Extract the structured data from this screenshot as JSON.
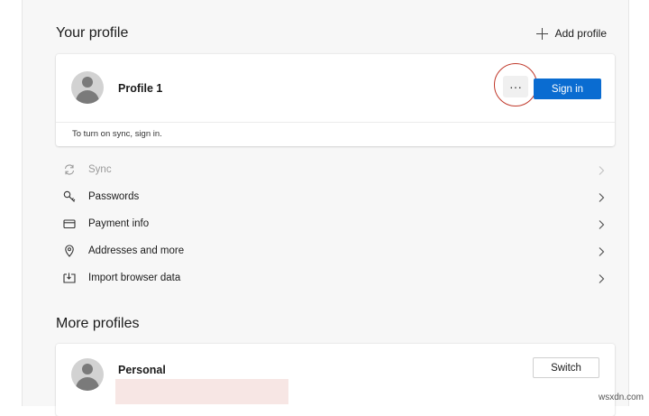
{
  "your_profile": {
    "title": "Your profile",
    "add_profile_label": "Add profile",
    "profile_name": "Profile 1",
    "more_label": "···",
    "sign_in_label": "Sign in",
    "sync_note": "To turn on sync, sign in."
  },
  "settings_items": [
    {
      "label": "Sync",
      "icon": "sync-icon",
      "disabled": true
    },
    {
      "label": "Passwords",
      "icon": "key-icon",
      "disabled": false
    },
    {
      "label": "Payment info",
      "icon": "credit-card-icon",
      "disabled": false
    },
    {
      "label": "Addresses and more",
      "icon": "location-pin-icon",
      "disabled": false
    },
    {
      "label": "Import browser data",
      "icon": "import-icon",
      "disabled": false
    }
  ],
  "more_profiles": {
    "title": "More profiles",
    "profile_name": "Personal",
    "switch_label": "Switch"
  },
  "watermark": "wsxdn.com",
  "colors": {
    "accent": "#0a6cd1",
    "highlight": "#c0392b"
  }
}
